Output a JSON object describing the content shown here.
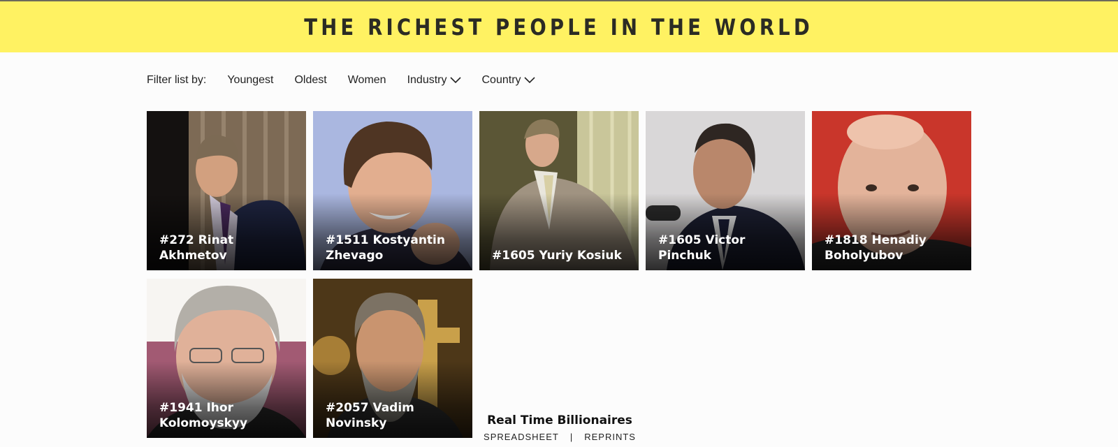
{
  "header": {
    "title": "THE RICHEST PEOPLE IN THE WORLD"
  },
  "filters": {
    "label": "Filter list by:",
    "items": [
      {
        "label": "Youngest",
        "dropdown": false
      },
      {
        "label": "Oldest",
        "dropdown": false
      },
      {
        "label": "Women",
        "dropdown": false
      },
      {
        "label": "Industry",
        "dropdown": true
      },
      {
        "label": "Country",
        "dropdown": true
      }
    ]
  },
  "cards": [
    {
      "name": "#272 Rinat Akhmetov",
      "icon": "person-photo"
    },
    {
      "name": "#1511 Kostyantin Zhevago",
      "icon": "person-photo"
    },
    {
      "name": "#1605 Yuriy Kosiuk",
      "icon": "person-photo"
    },
    {
      "name": "#1605 Victor Pinchuk",
      "icon": "person-photo"
    },
    {
      "name": "#1818 Henadiy Boholyubov",
      "icon": "person-photo"
    },
    {
      "name": "#1941 Ihor Kolomoyskyy",
      "icon": "person-photo"
    },
    {
      "name": "#2057 Vadim Novinsky",
      "icon": "person-photo"
    }
  ],
  "footer": {
    "title": "Real Time Billionaires",
    "links": [
      "SPREADSHEET",
      "|",
      "REPRINTS"
    ]
  },
  "colors": {
    "banner": "#fff262",
    "title": "#2b2b24"
  }
}
